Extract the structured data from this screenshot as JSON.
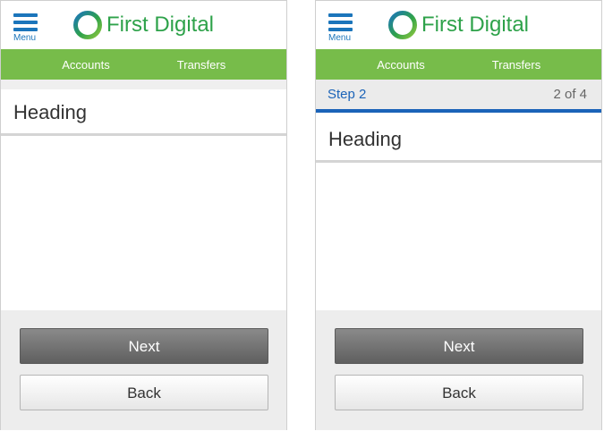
{
  "colors": {
    "brand_green": "#2ea24a",
    "nav_green": "#77bc4a",
    "accent_blue": "#1b63b8",
    "menu_blue": "#1b75bb"
  },
  "screens": [
    {
      "header": {
        "menu_label": "Menu",
        "menu_icon": "hamburger-icon",
        "logo_icon": "ring-logo-icon",
        "brand": "First Digital"
      },
      "nav": {
        "accounts": "Accounts",
        "transfers": "Transfers"
      },
      "heading": "Heading",
      "buttons": {
        "next": "Next",
        "back": "Back"
      }
    },
    {
      "header": {
        "menu_label": "Menu",
        "menu_icon": "hamburger-icon",
        "logo_icon": "ring-logo-icon",
        "brand": "First Digital"
      },
      "nav": {
        "accounts": "Accounts",
        "transfers": "Transfers"
      },
      "step": {
        "label": "Step 2",
        "count": "2 of 4"
      },
      "heading": "Heading",
      "buttons": {
        "next": "Next",
        "back": "Back"
      }
    }
  ]
}
